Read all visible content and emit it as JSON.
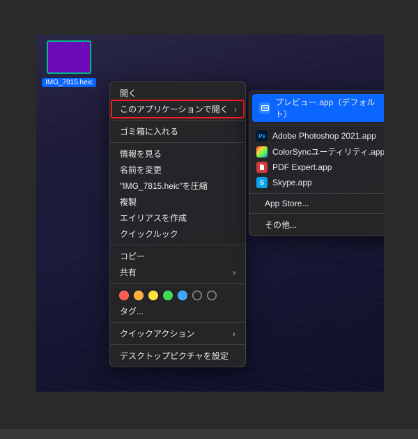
{
  "file": {
    "name": "IMG_7815.heic"
  },
  "context_menu": {
    "open": "開く",
    "open_with": "このアプリケーションで開く",
    "trash": "ゴミ箱に入れる",
    "get_info": "情報を見る",
    "rename": "名前を変更",
    "compress": "\"IMG_7815.heic\"を圧縮",
    "duplicate": "複製",
    "make_alias": "エイリアスを作成",
    "quick_look": "クイックルック",
    "copy": "コピー",
    "share": "共有",
    "tags": "タグ...",
    "quick_actions": "クイックアクション",
    "set_wallpaper": "デスクトップピクチャを設定"
  },
  "tag_colors": [
    "#ff5a52",
    "#ffb03a",
    "#ffe23a",
    "#3ddc4e",
    "#3da7ff",
    "#8e8e93",
    "#8e8e93"
  ],
  "submenu": {
    "preview": "プレビュー.app（デフォルト）",
    "photoshop": "Adobe Photoshop 2021.app",
    "colorsync": "ColorSyncユーティリティ.app",
    "pdfexpert": "PDF Expert.app",
    "skype": "Skype.app",
    "appstore": "App Store...",
    "other": "その他..."
  }
}
